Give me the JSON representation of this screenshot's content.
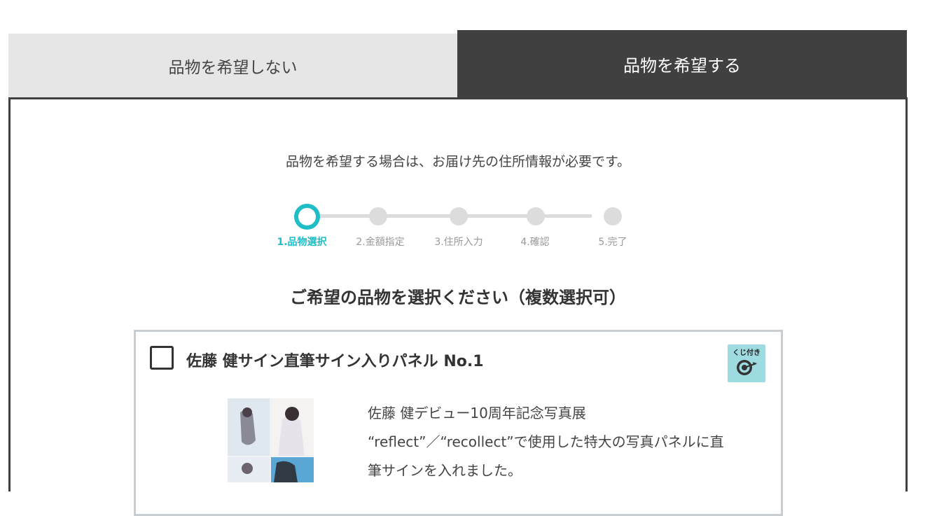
{
  "tabs": {
    "no_gift": "品物を希望しない",
    "want_gift": "品物を希望する"
  },
  "notice": "品物を希望する場合は、お届け先の住所情報が必要です。",
  "steps": [
    {
      "label": "1.品物選択",
      "active": true
    },
    {
      "label": "2.金額指定",
      "active": false
    },
    {
      "label": "3.住所入力",
      "active": false
    },
    {
      "label": "4.確認",
      "active": false
    },
    {
      "label": "5.完了",
      "active": false
    }
  ],
  "heading": "ご希望の品物を選択ください（複数選択可）",
  "item": {
    "title": "佐藤 健サイン直筆サイン入りパネル No.1",
    "checked": false,
    "badge": "くじ付き",
    "description_lines": [
      "佐藤 健デビュー10周年記念写真展",
      "“reflect”／“recollect”で使用した特大の写真パネルに直",
      "筆サインを入れました。"
    ]
  },
  "colors": {
    "accent": "#1fbec6",
    "tab_active_bg": "#404040",
    "tab_inactive_bg": "#e6e6e6",
    "badge_bg": "#9edbe0"
  },
  "icons": {
    "badge_icon": "target-icon"
  }
}
